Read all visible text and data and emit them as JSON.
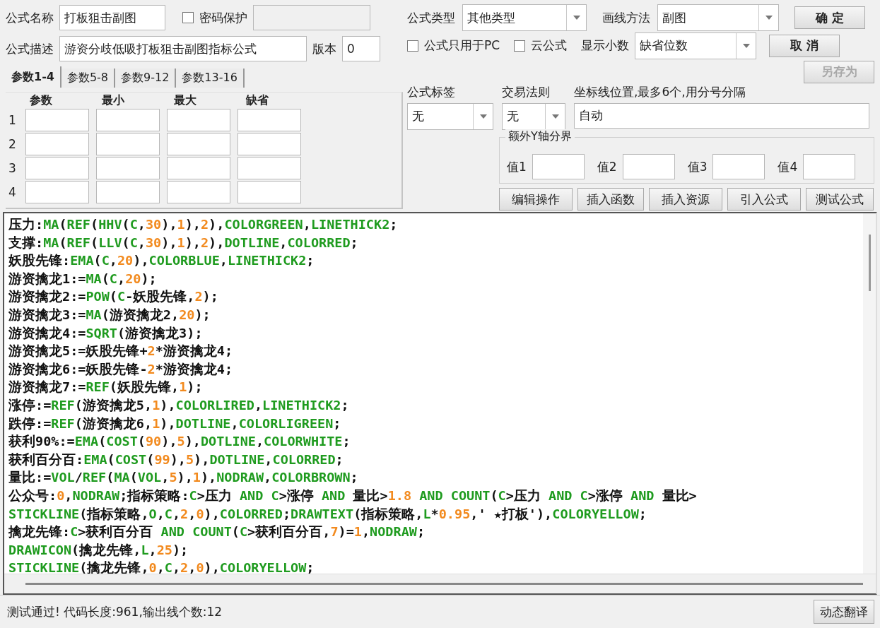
{
  "formula_name": {
    "label": "公式名称",
    "value": "打板狙击副图"
  },
  "password": {
    "label": "密码保护",
    "checked": false
  },
  "description": {
    "label": "公式描述",
    "value": "游资分歧低吸打板狙击副图指标公式"
  },
  "version": {
    "label": "版本",
    "value": "0"
  },
  "param_tabs": [
    {
      "label": "参数1-4",
      "selected": true
    },
    {
      "label": "参数5-8",
      "selected": false
    },
    {
      "label": "参数9-12",
      "selected": false
    },
    {
      "label": "参数13-16",
      "selected": false
    }
  ],
  "param_table": {
    "columns": [
      "参数",
      "最小",
      "最大",
      "缺省"
    ],
    "rows": [
      "1",
      "2",
      "3",
      "4"
    ]
  },
  "formula_type": {
    "label": "公式类型",
    "value": "其他类型"
  },
  "draw_method": {
    "label": "画线方法",
    "value": "副图"
  },
  "pc_only": {
    "label": "公式只用于PC",
    "checked": false
  },
  "cloud": {
    "label": "云公式",
    "checked": false
  },
  "decimals": {
    "label": "显示小数",
    "value": "缺省位数"
  },
  "dialog_buttons": [
    {
      "label": "确 定",
      "disabled": false
    },
    {
      "label": "取 消",
      "disabled": false
    },
    {
      "label": "另存为",
      "disabled": true
    }
  ],
  "tag": {
    "label": "公式标签",
    "value": "无"
  },
  "trade_rule": {
    "label": "交易法则",
    "value": "无"
  },
  "axis_lines": {
    "label": "坐标线位置,最多6个,用分号分隔",
    "value": "自动"
  },
  "y_bounds": {
    "title": "额外Y轴分界",
    "fields": [
      "值1",
      "值2",
      "值3",
      "值4"
    ]
  },
  "tool_buttons": [
    "编辑操作",
    "插入函数",
    "插入资源",
    "引入公式",
    "测试公式"
  ],
  "code_lines": [
    "压力:MA(REF(HHV(C,30),1),2),COLORGREEN,LINETHICK2;",
    "支撑:MA(REF(LLV(C,30),1),2),DOTLINE,COLORRED;",
    "妖股先锋:EMA(C,20),COLORBLUE,LINETHICK2;",
    "游资擒龙1:=MA(C,20);",
    "游资擒龙2:=POW(C-妖股先锋,2);",
    "游资擒龙3:=MA(游资擒龙2,20);",
    "游资擒龙4:=SQRT(游资擒龙3);",
    "游资擒龙5:=妖股先锋+2*游资擒龙4;",
    "游资擒龙6:=妖股先锋-2*游资擒龙4;",
    "游资擒龙7:=REF(妖股先锋,1);",
    "涨停:=REF(游资擒龙5,1),COLORLIRED,LINETHICK2;",
    "跌停:=REF(游资擒龙6,1),DOTLINE,COLORLIGREEN;",
    "获利90%:=EMA(COST(90),5),DOTLINE,COLORWHITE;",
    "获利百分百:EMA(COST(99),5),DOTLINE,COLORRED;",
    "量比:=VOL/REF(MA(VOL,5),1),NODRAW,COLORBROWN;",
    "公众号:0,NODRAW;指标策略:C>压力 AND C>涨停 AND 量比>1.8 AND COUNT(C>压力 AND C>涨停 AND 量比>",
    "STICKLINE(指标策略,O,C,2,0),COLORRED;DRAWTEXT(指标策略,L*0.95,' ★打板'),COLORYELLOW;",
    "擒龙先锋:C>获利百分百 AND COUNT(C>获利百分百,7)=1,NODRAW;",
    "DRAWICON(擒龙先锋,L,25);",
    "STICKLINE(擒龙先锋,0,C,2,0),COLORYELLOW;"
  ],
  "status": "测试通过! 代码长度:961,输出线个数:12",
  "translate_button": "动态翻译"
}
